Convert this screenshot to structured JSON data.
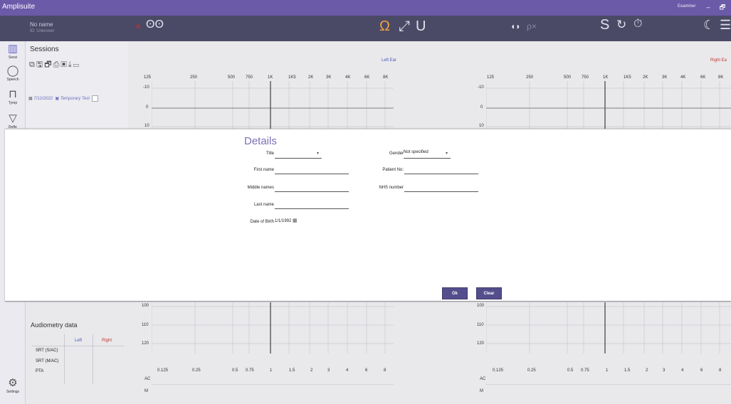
{
  "app": {
    "title": "Amplisuite",
    "examiner": "Examiner",
    "min": "–",
    "restore": "🗗"
  },
  "patient_bar": {
    "name": "No name",
    "id": "ID: Unknown"
  },
  "sidebar": {
    "items": [
      {
        "label": "Sessi",
        "icon": "grid-icon"
      },
      {
        "label": "Speech",
        "icon": "speech-bubble-icon"
      },
      {
        "label": "Tymp",
        "icon": "tymp-icon"
      },
      {
        "label": "Refle",
        "icon": "funnel-icon"
      },
      {
        "label": "Settings",
        "icon": "gear-icon"
      }
    ]
  },
  "sessions": {
    "title": "Sessions",
    "row_date": "7/12/2022",
    "row_name": "Temporary Test"
  },
  "charts": {
    "left_label": "Left Ear",
    "right_label": "Right Ea",
    "freqs_top": [
      "125",
      "250",
      "500",
      "750",
      "1K",
      "1K5",
      "2K",
      "3K",
      "4K",
      "6K",
      "8K"
    ],
    "db_top": [
      "-10",
      "0",
      "10"
    ],
    "db_bottom": [
      "100",
      "110",
      "120"
    ],
    "freqs_bottom": [
      "0.125",
      "0.25",
      "0.5",
      "0.75",
      "1",
      "1.5",
      "2",
      "3",
      "4",
      "6",
      "8"
    ],
    "row_ac": "AC",
    "row_m": "M"
  },
  "modal": {
    "title": "Details",
    "labels": {
      "title": "Title",
      "first_name": "First name",
      "middle_names": "Middle names",
      "last_name": "Last name",
      "dob": "Date of Birth",
      "gender": "Gender",
      "patient_no": "Patient No:",
      "nhs_number": "NHS number"
    },
    "values": {
      "title": "",
      "first_name": "",
      "middle_names": "",
      "last_name": "",
      "dob": "1/1/1992",
      "gender": "Not specified",
      "patient_no": "",
      "nhs_number": ""
    },
    "ok": "Ok",
    "clear": "Clear"
  },
  "audiometry": {
    "title": "Audiometry data",
    "col_left": "Left",
    "col_right": "Right",
    "rows": [
      "SRT (S/AC)",
      "SRT (M/AC)",
      "PTA"
    ]
  },
  "colors": {
    "titlebar": "#6a5aa8",
    "topbar": "#4b4a66",
    "accent": "#544e8c",
    "left_ear": "#4a56b8",
    "right_ear": "#c0392b"
  }
}
